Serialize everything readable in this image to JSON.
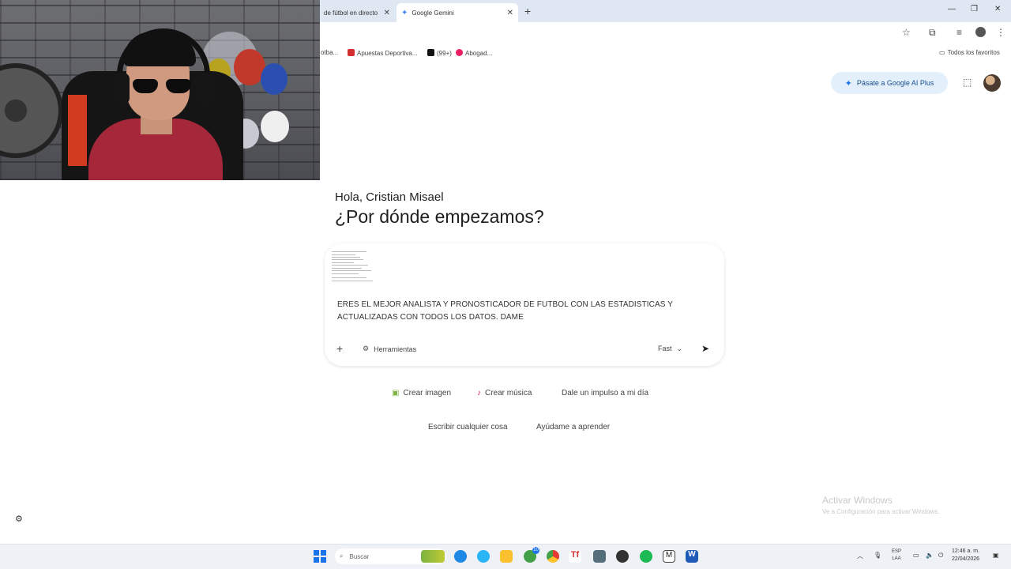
{
  "browser": {
    "tabs": [
      {
        "label": "de fútbol en directo",
        "active": false
      },
      {
        "label": "Google Gemini",
        "active": true
      }
    ],
    "bookmarks": [
      {
        "label": "otba..."
      },
      {
        "label": "Apuestas Deportiva..."
      },
      {
        "label": "(99+)"
      },
      {
        "label": "Abogad..."
      }
    ],
    "bookmarks_folder": "Todos los favoritos"
  },
  "gemini": {
    "upgrade_label": "Pásate a Google AI Plus",
    "greeting": "Hola, Cristian Misael",
    "headline": "¿Por dónde empezamos?",
    "prompt_text": "ERES EL MEJOR ANALISTA Y PRONOSTICADOR DE FUTBOL CON LAS ESTADISTICAS Y ACTUALIZADAS CON TODOS LOS DATOS. DAME",
    "tools_label": "Herramientas",
    "mode_label": "Fast",
    "chips": [
      {
        "label": "Crear imagen",
        "icon": "image-icon"
      },
      {
        "label": "Crear música",
        "icon": "music-icon"
      },
      {
        "label": "Dale un impulso a mi día",
        "icon": ""
      },
      {
        "label": "Escribir cualquier cosa",
        "icon": ""
      },
      {
        "label": "Ayúdame a aprender",
        "icon": ""
      }
    ]
  },
  "windows": {
    "watermark_title": "Activar Windows",
    "watermark_sub": "Ve a Configuración para activar Windows.",
    "search_placeholder": "Buscar",
    "whatsapp_badge": "10",
    "lang_top": "ESP",
    "lang_bottom": "LAA",
    "time": "12:46 a. m.",
    "date": "22/04/2026"
  },
  "colors": {
    "accent": "#1a73e8",
    "upgrade_bg": "#e3f0fb",
    "tabbar_bg": "#dfe7f3"
  }
}
